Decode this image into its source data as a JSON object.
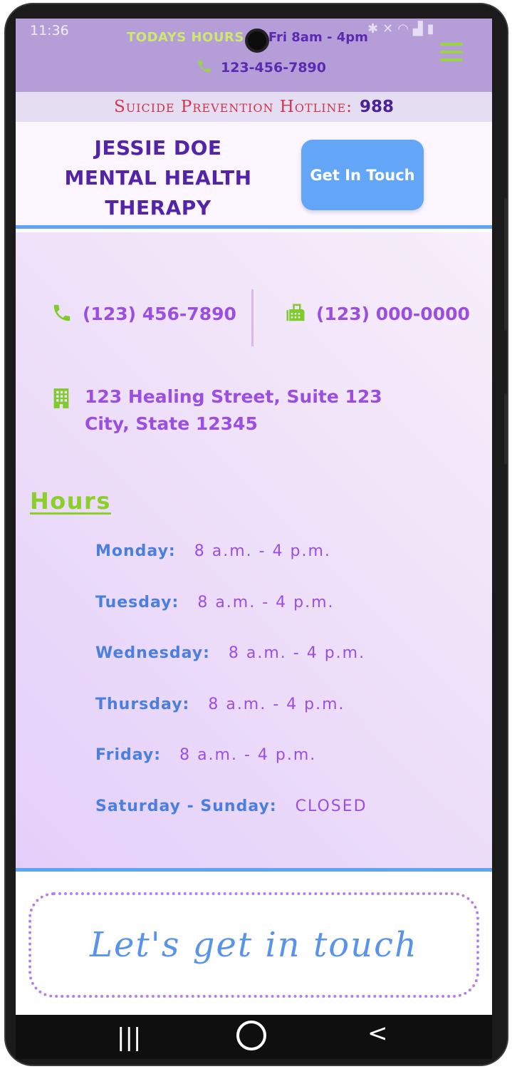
{
  "status_bar": {
    "time": "11:36",
    "icons": [
      "bluetooth-icon",
      "mute-icon",
      "wifi-icon",
      "signal-icon",
      "battery-icon"
    ]
  },
  "topbar": {
    "hours_label": "TODAYS HOURS",
    "hours_value": "Fri 8am - 4pm",
    "phone": "123-456-7890"
  },
  "hotline": {
    "label": "Suicide Prevention Hotline:",
    "number": "988"
  },
  "header": {
    "brand_line1": "JESSIE DOE",
    "brand_line2": "MENTAL HEALTH",
    "brand_line3": "THERAPY",
    "cta_label": "Get In Touch"
  },
  "contact": {
    "phone": "(123) 456-7890",
    "fax": "(123) 000-0000",
    "address_line1": "123 Healing Street, Suite 123",
    "address_line2": "City, State 12345"
  },
  "hours": {
    "title": "Hours",
    "rows": [
      {
        "day": "Monday:",
        "time": "8 a.m. - 4 p.m."
      },
      {
        "day": "Tuesday:",
        "time": "8 a.m. - 4 p.m."
      },
      {
        "day": "Wednesday:",
        "time": "8 a.m. - 4 p.m."
      },
      {
        "day": "Thursday:",
        "time": "8 a.m. - 4 p.m."
      },
      {
        "day": "Friday:",
        "time": "8 a.m. - 4 p.m."
      },
      {
        "day": "Saturday - Sunday:",
        "time": "CLOSED"
      }
    ]
  },
  "footer": {
    "touch_text": "Let's get in touch"
  },
  "colors": {
    "topbar_bg": "#b59ed8",
    "accent_green": "#8ccf2a",
    "brand_purple": "#5424a8",
    "accent_blue": "#5da4f4",
    "hotline_red": "#d0364b"
  }
}
